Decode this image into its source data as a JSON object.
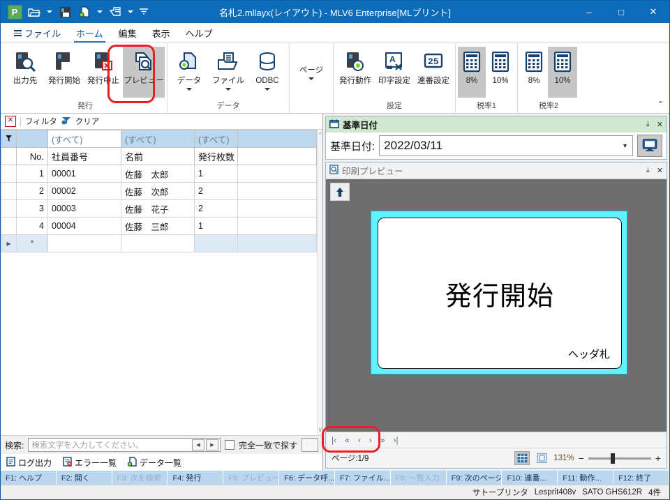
{
  "window": {
    "title": "名札2.mllayx(レイアウト) - MLV6 Enterprise[MLプリント]",
    "app_initial": "P",
    "minimize": "–",
    "maximize": "□",
    "close": "✕"
  },
  "quick_access": [
    {
      "name": "open-icon"
    },
    {
      "name": "open-dropdown"
    },
    {
      "name": "save-icon"
    },
    {
      "name": "new-data-icon"
    },
    {
      "name": "new-data-dropdown"
    },
    {
      "name": "print-icon"
    },
    {
      "name": "print-dropdown"
    },
    {
      "name": "customize-qat-dropdown"
    }
  ],
  "menu": {
    "tabs": [
      {
        "label": "ファイル",
        "active": false
      },
      {
        "label": "ホーム",
        "active": true
      },
      {
        "label": "編集",
        "active": false
      },
      {
        "label": "表示",
        "active": false
      },
      {
        "label": "ヘルプ",
        "active": false
      }
    ]
  },
  "ribbon": {
    "collapse_glyph": "⌃",
    "groups": [
      {
        "label": "発行",
        "items": [
          {
            "label": "出力先",
            "icon": "printer-search-icon",
            "selected": false,
            "caret": false
          },
          {
            "label": "発行開始",
            "icon": "printer-start-icon",
            "selected": false,
            "caret": false
          },
          {
            "label": "発行中止",
            "icon": "printer-stop-icon",
            "selected": false,
            "caret": false
          },
          {
            "label": "プレビュー",
            "icon": "preview-icon",
            "selected": true,
            "caret": false
          }
        ]
      },
      {
        "label": "データ",
        "items": [
          {
            "label": "データ",
            "icon": "data-gear-icon",
            "selected": false,
            "caret": true
          },
          {
            "label": "ファイル",
            "icon": "file-open-icon",
            "selected": false,
            "caret": true
          },
          {
            "label": "ODBC",
            "icon": "database-icon",
            "selected": false,
            "caret": true
          }
        ]
      },
      {
        "label": "",
        "items": [
          {
            "label": "ページ",
            "icon": "",
            "selected": false,
            "caret": true
          }
        ]
      },
      {
        "label": "設定",
        "items": [
          {
            "label": "発行動作",
            "icon": "printer-gear-icon",
            "selected": false,
            "caret": false
          },
          {
            "label": "印字設定",
            "icon": "font-settings-icon",
            "selected": false,
            "caret": false
          },
          {
            "label": "連番設定",
            "icon": "serial-number-icon",
            "selected": false,
            "caret": false
          }
        ]
      },
      {
        "label": "税率1",
        "items": [
          {
            "label": "8%",
            "icon": "calculator-icon",
            "selected": true,
            "caret": false
          },
          {
            "label": "10%",
            "icon": "calculator-icon",
            "selected": false,
            "caret": false
          }
        ]
      },
      {
        "label": "税率2",
        "items": [
          {
            "label": "8%",
            "icon": "calculator-icon",
            "selected": false,
            "caret": false
          },
          {
            "label": "10%",
            "icon": "calculator-icon",
            "selected": true,
            "caret": false
          }
        ]
      }
    ]
  },
  "filter_toolbar": {
    "close_label": "✕",
    "filter_label": "フィルタ",
    "clear_label": "クリア"
  },
  "grid": {
    "filter_row": [
      "",
      "",
      "(すべて)",
      "(すべて)",
      "(すべて)",
      ""
    ],
    "headers": [
      "",
      "No.",
      "社員番号",
      "名前",
      "発行枚数",
      ""
    ],
    "rows": [
      {
        "no": "1",
        "id": "00001",
        "name": "佐藤　太郎",
        "qty": "1"
      },
      {
        "no": "2",
        "id": "00002",
        "name": "佐藤　次郎",
        "qty": "2"
      },
      {
        "no": "3",
        "id": "00003",
        "name": "佐藤　花子",
        "qty": "2"
      },
      {
        "no": "4",
        "id": "00004",
        "name": "佐藤　三郎",
        "qty": "1"
      }
    ],
    "new_row_marker": "*",
    "new_row_arrow": "▶"
  },
  "search": {
    "label": "検索:",
    "placeholder": "検索文字を入力してください。",
    "prev_glyph": "◀",
    "next_glyph": "▶",
    "exact_match_label": "完全一致で探す",
    "exact_match_checked": false
  },
  "bottom_tabs": [
    {
      "label": "ログ出力",
      "icon": "log-output-icon"
    },
    {
      "label": "エラー一覧",
      "icon": "error-list-icon"
    },
    {
      "label": "データ一覧",
      "icon": "data-list-icon"
    }
  ],
  "date_panel": {
    "title": "基準日付",
    "icon": "calendar-icon",
    "pin_glyph": "⤓",
    "close_glyph": "✕",
    "field_label": "基準日付:",
    "field_value": "2022/03/11",
    "dropdown_glyph": "▼",
    "monitor_button": "monitor-icon"
  },
  "preview_panel": {
    "title": "印刷プレビュー",
    "icon": "preview-page-icon",
    "pin_glyph": "⤓",
    "close_glyph": "✕",
    "scroll_up_glyph": "↑",
    "label_main_text": "発行開始",
    "label_sub_text": "ヘッダ札",
    "label_border_color": "#5ff4ff"
  },
  "preview_nav": {
    "buttons": [
      "|‹",
      "«",
      "‹",
      "›",
      "»",
      "›|"
    ],
    "page_text": "ページ:1/9",
    "view_grid_icon": "grid-view-icon",
    "view_single_icon": "single-page-view-icon",
    "zoom_percent": "131%",
    "zoom_out": "−",
    "zoom_in": "+"
  },
  "function_keys": [
    {
      "label": "F1: ヘルプ",
      "disabled": false
    },
    {
      "label": "F2: 開く",
      "disabled": false
    },
    {
      "label": "F3: 次を検索",
      "disabled": true
    },
    {
      "label": "F4: 発行",
      "disabled": false
    },
    {
      "label": "F5: プレビュー",
      "disabled": true
    },
    {
      "label": "F6: データ呼...",
      "disabled": false
    },
    {
      "label": "F7: ファイル...",
      "disabled": false
    },
    {
      "label": "F8: 一覧入力",
      "disabled": true
    },
    {
      "label": "F9: 次のページ",
      "disabled": false
    },
    {
      "label": "F10: 連番...",
      "disabled": false
    },
    {
      "label": "F11: 動作...",
      "disabled": false
    },
    {
      "label": "F12: 終了",
      "disabled": false
    }
  ],
  "status_bar": {
    "printer_type": "サトープリンタ",
    "printer_model": "Lesprit408v",
    "printer_name": "SATO GHS612R",
    "record_count": "4件"
  }
}
